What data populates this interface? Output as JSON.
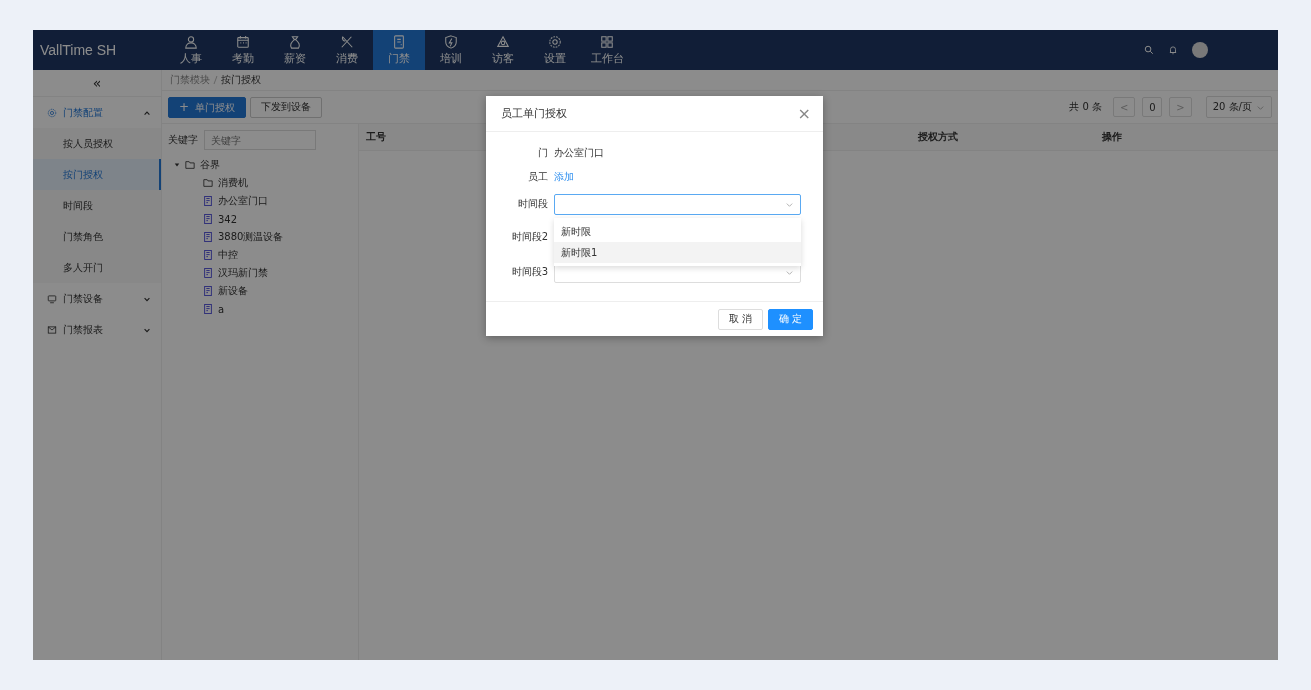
{
  "app": {
    "logo": "VallTime SH"
  },
  "nav": [
    {
      "label": "人事",
      "kind": "person",
      "selected": false
    },
    {
      "label": "考勤",
      "kind": "calendar",
      "selected": false
    },
    {
      "label": "薪资",
      "kind": "bag",
      "selected": false
    },
    {
      "label": "消费",
      "kind": "fork",
      "selected": false
    },
    {
      "label": "门禁",
      "kind": "door",
      "selected": true
    },
    {
      "label": "培训",
      "kind": "shield",
      "selected": false
    },
    {
      "label": "访客",
      "kind": "triangle",
      "selected": false
    },
    {
      "label": "设置",
      "kind": "gear",
      "selected": false
    },
    {
      "label": "工作台",
      "kind": "grid",
      "selected": false
    }
  ],
  "sidebar": {
    "collapse": "«",
    "items": [
      {
        "label": "门禁配置",
        "kind": "gear",
        "expanded": true,
        "children": [
          {
            "label": "按人员授权",
            "selected": false
          },
          {
            "label": "按门授权",
            "selected": true
          },
          {
            "label": "时间段",
            "selected": false
          },
          {
            "label": "门禁角色",
            "selected": false
          },
          {
            "label": "多人开门",
            "selected": false
          }
        ]
      },
      {
        "label": "门禁设备",
        "kind": "monitor",
        "expanded": false
      },
      {
        "label": "门禁报表",
        "kind": "mail",
        "expanded": false
      }
    ]
  },
  "breadcrumb": [
    "门禁模块",
    "按门授权"
  ],
  "toolbar": {
    "primary": "单门授权",
    "primary_icon": "+",
    "secondary": "下发到设备"
  },
  "pagination": {
    "total": "共 0 条",
    "prev": "<",
    "page": "0",
    "next": ">",
    "page_size": "20 条/页"
  },
  "tree": {
    "keyword_label": "关键字",
    "placeholder": "关键字",
    "nodes": [
      {
        "label": "谷界",
        "kind": "folder",
        "expanded": true,
        "children": [
          {
            "label": "消费机",
            "kind": "folder"
          },
          {
            "label": "办公室门口",
            "kind": "device"
          },
          {
            "label": "342",
            "kind": "device"
          },
          {
            "label": "3880测温设备",
            "kind": "device"
          },
          {
            "label": "中控",
            "kind": "device"
          },
          {
            "label": "汉玛新门禁",
            "kind": "device"
          },
          {
            "label": "新设备",
            "kind": "device"
          },
          {
            "label": "a",
            "kind": "device"
          }
        ]
      }
    ]
  },
  "table": {
    "columns": [
      "工号",
      "授权方式",
      "操作"
    ]
  },
  "dialog": {
    "title": "员工单门授权",
    "close": "×",
    "fields": [
      {
        "label": "门",
        "kind": "text",
        "value": "办公室门口"
      },
      {
        "label": "员工",
        "kind": "link",
        "value": "添加"
      },
      {
        "label": "时间段",
        "kind": "select",
        "focused": true
      },
      {
        "label": "时间段2",
        "kind": "covered"
      },
      {
        "label": "时间段3",
        "kind": "select",
        "focused": false
      }
    ],
    "dropdown": [
      {
        "label": "新时限",
        "highlighted": false
      },
      {
        "label": "新时限1",
        "highlighted": true
      }
    ],
    "cancel": "取 消",
    "ok": "确 定"
  }
}
